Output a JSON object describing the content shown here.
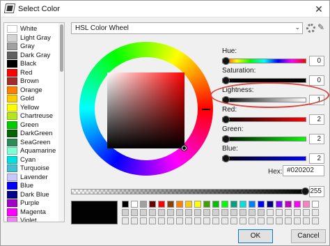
{
  "window": {
    "title": "Select Color"
  },
  "colors": [
    {
      "name": "White",
      "hex": "#ffffff"
    },
    {
      "name": "Light Gray",
      "hex": "#d4d4d4"
    },
    {
      "name": "Gray",
      "hex": "#a0a0a0"
    },
    {
      "name": "Dark Gray",
      "hex": "#606060"
    },
    {
      "name": "Black",
      "hex": "#000000"
    },
    {
      "name": "Red",
      "hex": "#ff0000"
    },
    {
      "name": "Brown",
      "hex": "#a52a2a"
    },
    {
      "name": "Orange",
      "hex": "#ff8000"
    },
    {
      "name": "Gold",
      "hex": "#ffcc00"
    },
    {
      "name": "Yellow",
      "hex": "#ffff00"
    },
    {
      "name": "Chartreuse",
      "hex": "#b5e61d"
    },
    {
      "name": "Green",
      "hex": "#00cc00"
    },
    {
      "name": "DarkGreen",
      "hex": "#006400"
    },
    {
      "name": "SeaGreen",
      "hex": "#2e8b57"
    },
    {
      "name": "Aquamarine",
      "hex": "#7fffd4"
    },
    {
      "name": "Cyan",
      "hex": "#00e0e0"
    },
    {
      "name": "Turquoise",
      "hex": "#40c0d0"
    },
    {
      "name": "Lavender",
      "hex": "#c8c8ff"
    },
    {
      "name": "Blue",
      "hex": "#0000ff"
    },
    {
      "name": "Dark Blue",
      "hex": "#00008b"
    },
    {
      "name": "Purple",
      "hex": "#a000c8"
    },
    {
      "name": "Magenta",
      "hex": "#ff00ff"
    },
    {
      "name": "Violet",
      "hex": "#ee82ee"
    }
  ],
  "mode": {
    "label": "HSL Color Wheel"
  },
  "sliders": [
    {
      "label": "Hue:",
      "value": "0",
      "gradient": "linear-gradient(to right,#f00,#ff0,#0f0,#0ff,#00f,#f0f,#f00)",
      "pos": 0
    },
    {
      "label": "Saturation:",
      "value": "0",
      "gradient": "linear-gradient(to right,#020202,#030101)",
      "pos": 0
    },
    {
      "label": "Lightness:",
      "value": "1",
      "gradient": "linear-gradient(to right,#000,#7f7f7f,#fff)",
      "pos": 0
    },
    {
      "label": "Red:",
      "value": "2",
      "gradient": "linear-gradient(to right,#020202,#ff0202)",
      "pos": 0
    },
    {
      "label": "Green:",
      "value": "2",
      "gradient": "linear-gradient(to right,#020202,#02ff02)",
      "pos": 0
    },
    {
      "label": "Blue:",
      "value": "2",
      "gradient": "linear-gradient(to right,#020202,#0202ff)",
      "pos": 0
    }
  ],
  "hex": {
    "label": "Hex:",
    "value": "#020202"
  },
  "alpha": {
    "value": "255"
  },
  "current_color": "#020202",
  "swatch_row1": [
    "#000000",
    "#ffffff",
    "#a0a0a0",
    "#6a0000",
    "#ff0000",
    "#8a4000",
    "#ff7f00",
    "#ffcc00",
    "#ffff00",
    "#40a000",
    "#00c000",
    "#00ff00",
    "#00a080",
    "#00e0e0",
    "#0080ff",
    "#0000ff",
    "#000080",
    "#8000ff",
    "#c000c0",
    "#ff00ff",
    "#ff80c0",
    "#ffffff"
  ],
  "buttons": {
    "ok": "OK",
    "cancel": "Cancel"
  }
}
